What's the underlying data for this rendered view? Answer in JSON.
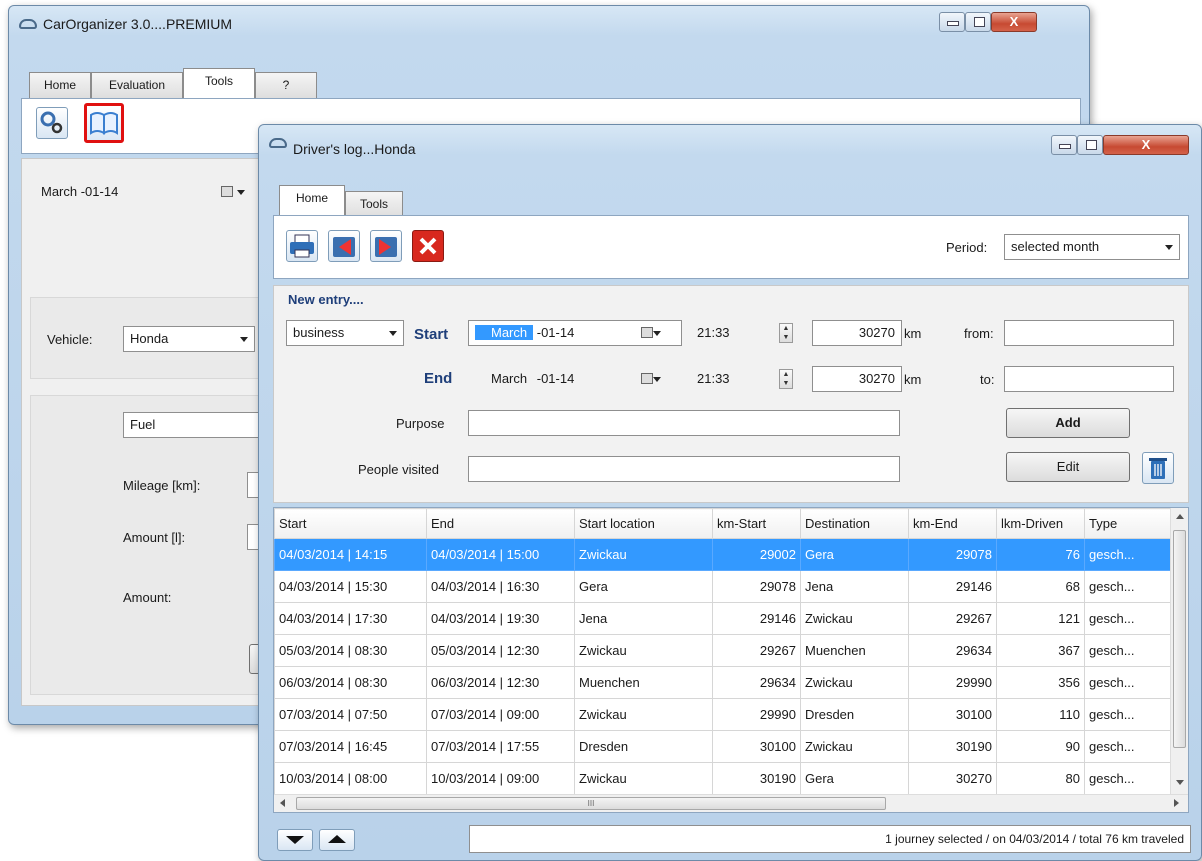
{
  "main_window": {
    "title": "CarOrganizer 3.0....PREMIUM",
    "tabs": [
      {
        "label": "Home"
      },
      {
        "label": "Evaluation"
      },
      {
        "label": "Tools"
      },
      {
        "label": "?"
      }
    ],
    "date_value": "March  -01-14",
    "vehicle_label": "Vehicle:",
    "vehicle_value": "Honda",
    "category_value": "Fuel",
    "mileage_label": "Mileage [km]:",
    "amount_l_label": "Amount [l]:",
    "amount_label": "Amount:"
  },
  "log_window": {
    "title": "Driver's log...Honda",
    "tabs": [
      {
        "label": "Home"
      },
      {
        "label": "Tools"
      }
    ],
    "period_label": "Period:",
    "period_value": "selected month",
    "new_entry_label": "New entry....",
    "type_value": "business",
    "start_label": "Start",
    "end_label": "End",
    "start_month": "March",
    "start_date_rest": "-01-14",
    "end_month": "March",
    "end_date_rest": "-01-14",
    "start_time": "21:33",
    "end_time": "21:33",
    "start_km": "30270",
    "end_km": "30270",
    "km_unit": "km",
    "from_label": "from:",
    "to_label": "to:",
    "purpose_label": "Purpose",
    "people_label": "People visited",
    "add_label": "Add",
    "edit_label": "Edit",
    "table": {
      "columns": [
        "Start",
        "End",
        "Start location",
        "km-Start",
        "Destination",
        "km-End",
        "lkm-Driven",
        "Type"
      ],
      "rows": [
        [
          "04/03/2014 | 14:15",
          "04/03/2014 | 15:00",
          "Zwickau",
          "29002",
          "Gera",
          "29078",
          "76",
          "gesch..."
        ],
        [
          "04/03/2014 | 15:30",
          "04/03/2014 | 16:30",
          "Gera",
          "29078",
          "Jena",
          "29146",
          "68",
          "gesch..."
        ],
        [
          "04/03/2014 | 17:30",
          "04/03/2014 | 19:30",
          "Jena",
          "29146",
          "Zwickau",
          "29267",
          "121",
          "gesch..."
        ],
        [
          "05/03/2014 | 08:30",
          "05/03/2014 | 12:30",
          "Zwickau",
          "29267",
          "Muenchen",
          "29634",
          "367",
          "gesch..."
        ],
        [
          "06/03/2014 | 08:30",
          "06/03/2014 | 12:30",
          "Muenchen",
          "29634",
          "Zwickau",
          "29990",
          "356",
          "gesch..."
        ],
        [
          "07/03/2014 | 07:50",
          "07/03/2014 | 09:00",
          "Zwickau",
          "29990",
          "Dresden",
          "30100",
          "110",
          "gesch..."
        ],
        [
          "07/03/2014 | 16:45",
          "07/03/2014 | 17:55",
          "Dresden",
          "30100",
          "Zwickau",
          "30190",
          "90",
          "gesch..."
        ],
        [
          "10/03/2014 | 08:00",
          "10/03/2014 | 09:00",
          "Zwickau",
          "30190",
          "Gera",
          "30270",
          "80",
          "gesch..."
        ]
      ],
      "selected_row": 0
    },
    "status_text": "1 journey selected / on 04/03/2014 / total 76 km traveled",
    "hscroll_grip": "III"
  },
  "colors": {
    "selection": "#3399ff",
    "close_button": "#c74a32",
    "highlight_border": "#e01010"
  }
}
